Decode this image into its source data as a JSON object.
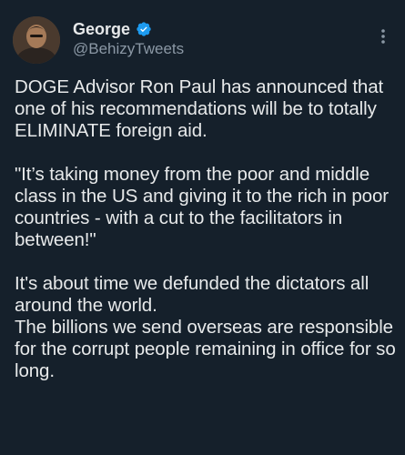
{
  "author": {
    "display_name": "George",
    "handle": "@BehizyTweets",
    "verified": true,
    "verified_color": "#1d9bf0"
  },
  "tweet": {
    "paragraphs": [
      "DOGE Advisor Ron Paul has announced that one of his recommendations will be to totally ELIMINATE foreign aid.",
      "\"It’s taking money from the poor and middle class in the US and giving it to the rich in poor countries  - with a cut to the facilitators in between!\"",
      "It's about time we defunded the dictators all around the world.\nThe billions we send overseas are responsible for the corrupt people remaining in office for so long."
    ]
  },
  "icons": {
    "avatar": "profile-photo",
    "verified": "verified-badge-icon",
    "more": "more-options-icon"
  },
  "colors": {
    "background": "#15202b",
    "text": "#e7e9ea",
    "secondary_text": "#8b98a5"
  }
}
